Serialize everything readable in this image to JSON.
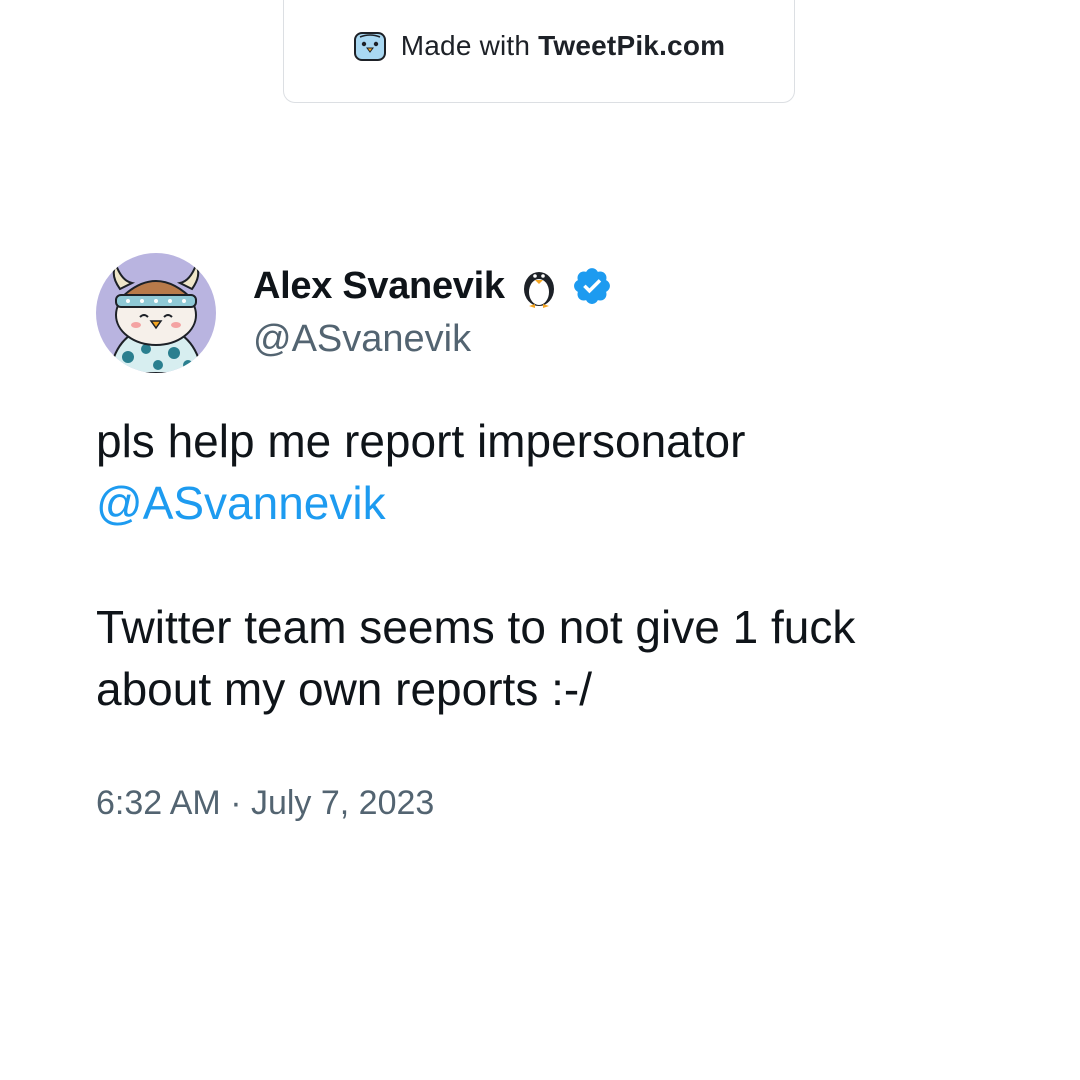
{
  "watermark": {
    "prefix": "Made with ",
    "brand": "TweetPik.com",
    "icon": "bird-mascot-icon"
  },
  "author": {
    "display_name": "Alex Svanevik",
    "handle": "@ASvanevik",
    "name_emoji": "penguin-icon",
    "badge": "verified-icon",
    "avatar": "penguin-viking-avatar"
  },
  "tweet": {
    "line1": "pls help me report impersonator",
    "mention": "@ASvannevik",
    "line3": "Twitter team seems to not give 1 fuck",
    "line4": "about my own reports :-/"
  },
  "timestamp": "6:32 AM · July 7, 2023",
  "colors": {
    "text": "#0f1419",
    "secondary": "#536471",
    "mention": "#1d9bf0",
    "verified": "#1d9bf0",
    "avatar_bg": "#b9b4e0"
  }
}
